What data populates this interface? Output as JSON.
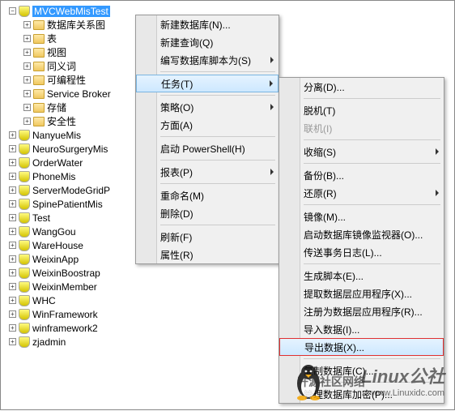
{
  "tree": {
    "selected": "MVCWebMisTest",
    "selected_children": [
      "数据库关系图",
      "表",
      "视图",
      "同义词",
      "可编程性",
      "Service Broker",
      "存储",
      "安全性"
    ],
    "siblings": [
      "NanyueMis",
      "NeuroSurgeryMis",
      "OrderWater",
      "PhoneMis",
      "ServerModeGridP",
      "SpinePatientMis",
      "Test",
      "WangGou",
      "WareHouse",
      "WeixinApp",
      "WeixinBoostrap",
      "WeixinMember",
      "WHC",
      "WinFramework",
      "winframework2",
      "zjadmin"
    ]
  },
  "menu1": {
    "items": [
      {
        "label": "新建数据库(N)...",
        "sub": false
      },
      {
        "label": "新建查询(Q)",
        "sub": false
      },
      {
        "label": "编写数据库脚本为(S)",
        "sub": true
      },
      {
        "sep": true
      },
      {
        "label": "任务(T)",
        "sub": true,
        "hl": true
      },
      {
        "sep": true
      },
      {
        "label": "策略(O)",
        "sub": true
      },
      {
        "label": "方面(A)",
        "sub": false
      },
      {
        "sep": true
      },
      {
        "label": "启动 PowerShell(H)",
        "sub": false
      },
      {
        "sep": true
      },
      {
        "label": "报表(P)",
        "sub": true
      },
      {
        "sep": true
      },
      {
        "label": "重命名(M)",
        "sub": false
      },
      {
        "label": "删除(D)",
        "sub": false
      },
      {
        "sep": true
      },
      {
        "label": "刷新(F)",
        "sub": false
      },
      {
        "label": "属性(R)",
        "sub": false
      }
    ]
  },
  "menu2": {
    "items": [
      {
        "label": "分离(D)...",
        "sub": false
      },
      {
        "sep": true
      },
      {
        "label": "脱机(T)",
        "sub": false
      },
      {
        "label": "联机(I)",
        "sub": false,
        "dis": true
      },
      {
        "sep": true
      },
      {
        "label": "收缩(S)",
        "sub": true
      },
      {
        "sep": true
      },
      {
        "label": "备份(B)...",
        "sub": false
      },
      {
        "label": "还原(R)",
        "sub": true
      },
      {
        "sep": true
      },
      {
        "label": "镜像(M)...",
        "sub": false
      },
      {
        "label": "启动数据库镜像监视器(O)...",
        "sub": false
      },
      {
        "label": "传送事务日志(L)...",
        "sub": false
      },
      {
        "sep": true
      },
      {
        "label": "生成脚本(E)...",
        "sub": false
      },
      {
        "label": "提取数据层应用程序(X)...",
        "sub": false
      },
      {
        "label": "注册为数据层应用程序(R)...",
        "sub": false
      },
      {
        "label": "导入数据(I)...",
        "sub": false
      },
      {
        "label": "导出数据(X)...",
        "sub": false,
        "red": true
      },
      {
        "sep": true
      },
      {
        "label": "复制数据库(C)...",
        "sub": false
      },
      {
        "sep": true
      },
      {
        "label": "管理数据库加密(P)...",
        "sub": false
      }
    ]
  },
  "watermark": {
    "logo": "Linux公社",
    "url": "www.Linuxidc.com",
    "sub": "开源社区网络"
  },
  "glyphs": {
    "plus": "+",
    "minus": "−"
  }
}
